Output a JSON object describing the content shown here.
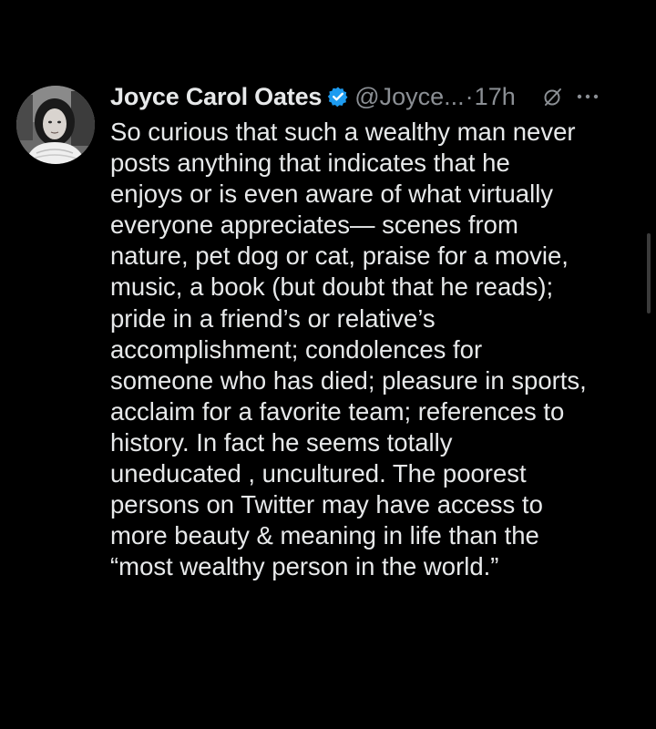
{
  "tweet": {
    "author": {
      "display_name": "Joyce Carol Oates",
      "handle": "@Joyce...",
      "verified_icon": "verified-badge-icon",
      "avatar": "avatar-photo"
    },
    "separator": "·",
    "timestamp": "17h",
    "actions": {
      "grok_icon": "grok-icon",
      "more_icon": "more-options-icon"
    },
    "text": "So curious that such a wealthy man never\nposts anything that indicates that he\nenjoys or is even aware of what virtually\neveryone appreciates— scenes from\nnature, pet dog or cat, praise for a movie,\nmusic, a book (but doubt that he reads);\npride in a friend’s or relative’s\naccomplishment; condolences for\nsomeone who has died; pleasure in sports,\nacclaim for a favorite team;  references to\nhistory.  In fact he seems totally\nuneducated , uncultured. The poorest\npersons on Twitter may have access to\nmore beauty & meaning in life than the\n“most wealthy person in the world.”"
  },
  "colors": {
    "background": "#000000",
    "text_primary": "#e7e9ea",
    "text_secondary": "#8b8f94",
    "verified_blue": "#1d9bf0"
  }
}
